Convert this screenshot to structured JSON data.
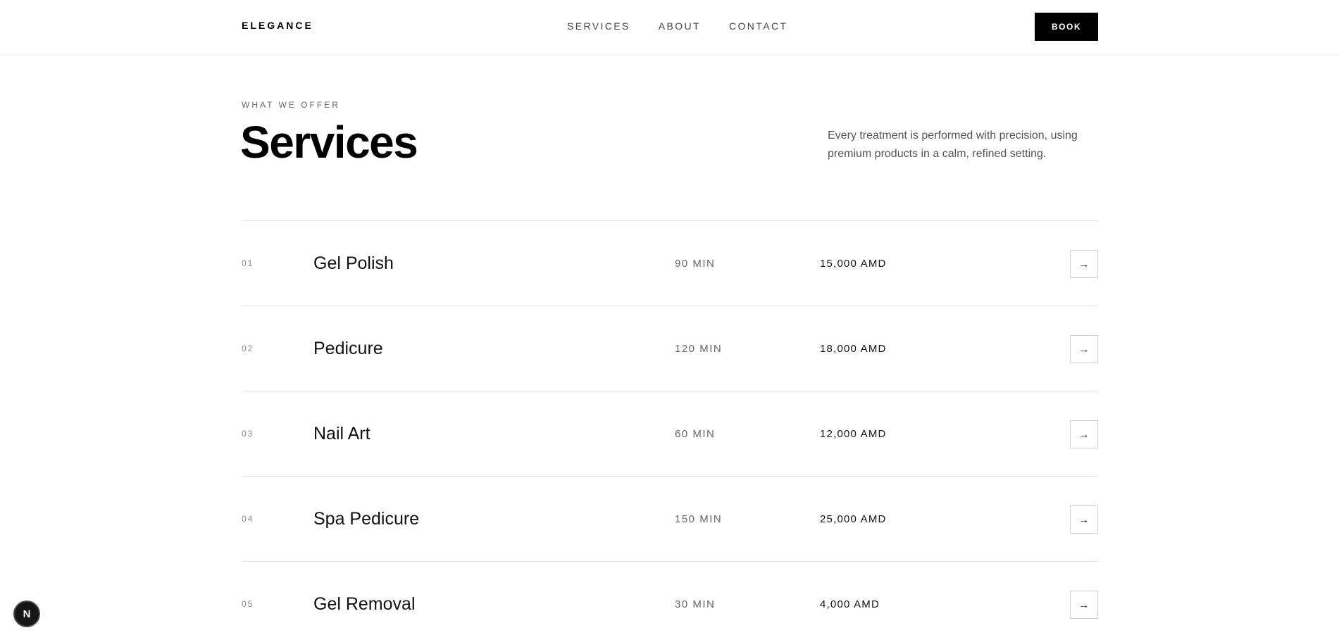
{
  "header": {
    "brand": "ELEGANCE",
    "nav": [
      {
        "label": "SERVICES"
      },
      {
        "label": "ABOUT"
      },
      {
        "label": "CONTACT"
      }
    ],
    "book_label": "BOOK"
  },
  "intro": {
    "eyebrow": "WHAT WE OFFER",
    "title": "Services",
    "description": "Every treatment is performed with precision, using premium products in a calm, refined setting."
  },
  "services": [
    {
      "num": "01",
      "name": "Gel Polish",
      "duration": "90 MIN",
      "price": "15,000 AMD",
      "arrow": "→"
    },
    {
      "num": "02",
      "name": "Pedicure",
      "duration": "120 MIN",
      "price": "18,000 AMD",
      "arrow": "→"
    },
    {
      "num": "03",
      "name": "Nail Art",
      "duration": "60 MIN",
      "price": "12,000 AMD",
      "arrow": "→"
    },
    {
      "num": "04",
      "name": "Spa Pedicure",
      "duration": "150 MIN",
      "price": "25,000 AMD",
      "arrow": "→"
    },
    {
      "num": "05",
      "name": "Gel Removal",
      "duration": "30 MIN",
      "price": "4,000 AMD",
      "arrow": "→"
    }
  ],
  "dev_badge": {
    "label": "N",
    "icon": "nextjs-logo-icon"
  },
  "colors": {
    "accent": "#000000",
    "background": "#ffffff",
    "divider": "#e5e5e5"
  }
}
